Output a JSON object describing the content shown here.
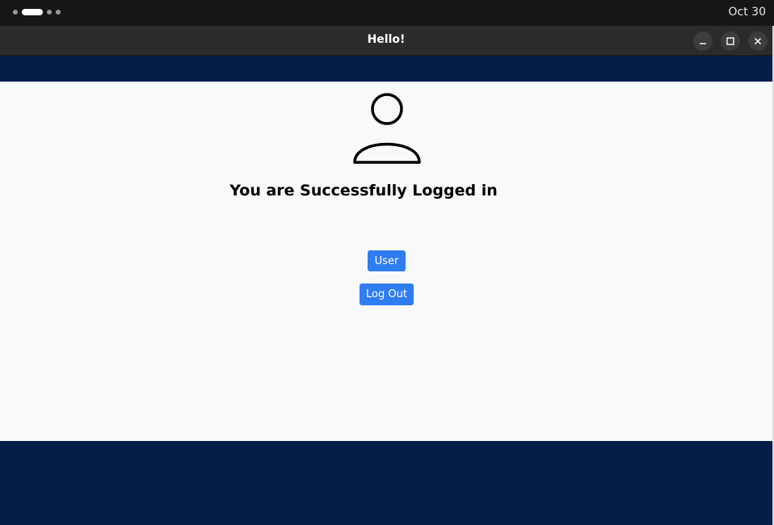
{
  "system_bar": {
    "clock": "Oct 30"
  },
  "window": {
    "title": "Hello!"
  },
  "main": {
    "user_icon": "user-profile-icon",
    "headline": "You are Successfully Logged in",
    "user_button_label": "User",
    "logout_button_label": "Log Out"
  },
  "colors": {
    "accent": "#2f7df0",
    "navy_background": "#051e48",
    "content_background": "#f7f9fb"
  }
}
